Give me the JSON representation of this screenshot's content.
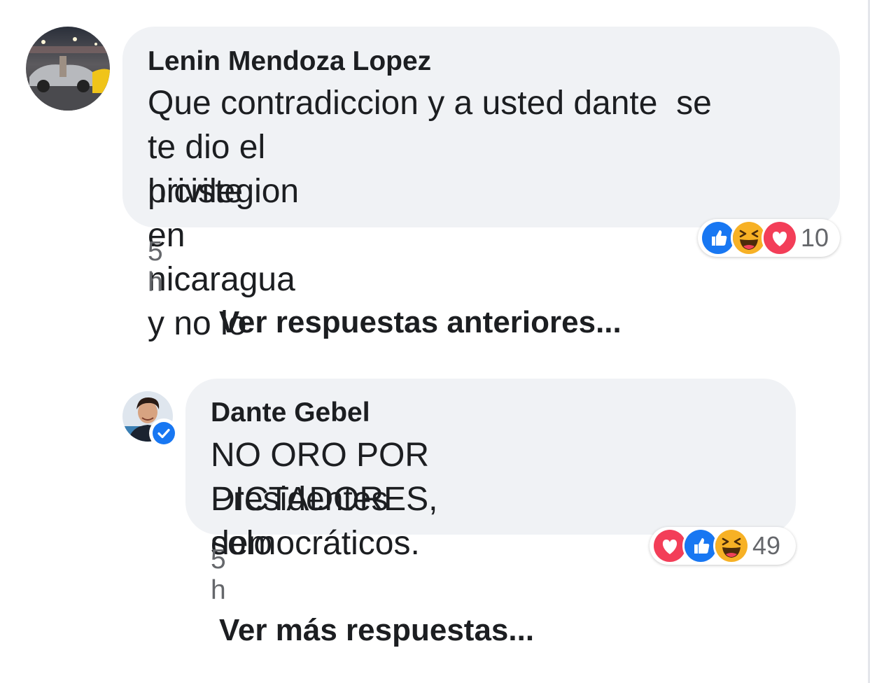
{
  "comments": [
    {
      "author": "Lenin Mendoza Lopez",
      "text_lines": [
        "Que contradiccion y a usted dante  se",
        "te dio el privilegion en nicaragua y no lo",
        "hiciste ."
      ],
      "time": "5 h",
      "reactions": [
        "like-icon",
        "haha-icon",
        "love-icon"
      ],
      "reaction_count": "10"
    },
    {
      "author": "Dante Gebel",
      "verified": true,
      "text_lines": [
        "NO ORO POR DICTADORES, solo",
        "Presidentes democráticos."
      ],
      "time": "5 h",
      "reactions": [
        "love-icon",
        "like-icon",
        "haha-icon"
      ],
      "reaction_count": "49"
    }
  ],
  "links": {
    "previous_replies": "Ver respuestas anteriores...",
    "more_replies": "Ver más respuestas..."
  },
  "colors": {
    "bubble": "#f0f2f5",
    "like": "#1877f2",
    "love": "#f33e58",
    "haha": "#f7b125",
    "verified": "#1877f2"
  }
}
